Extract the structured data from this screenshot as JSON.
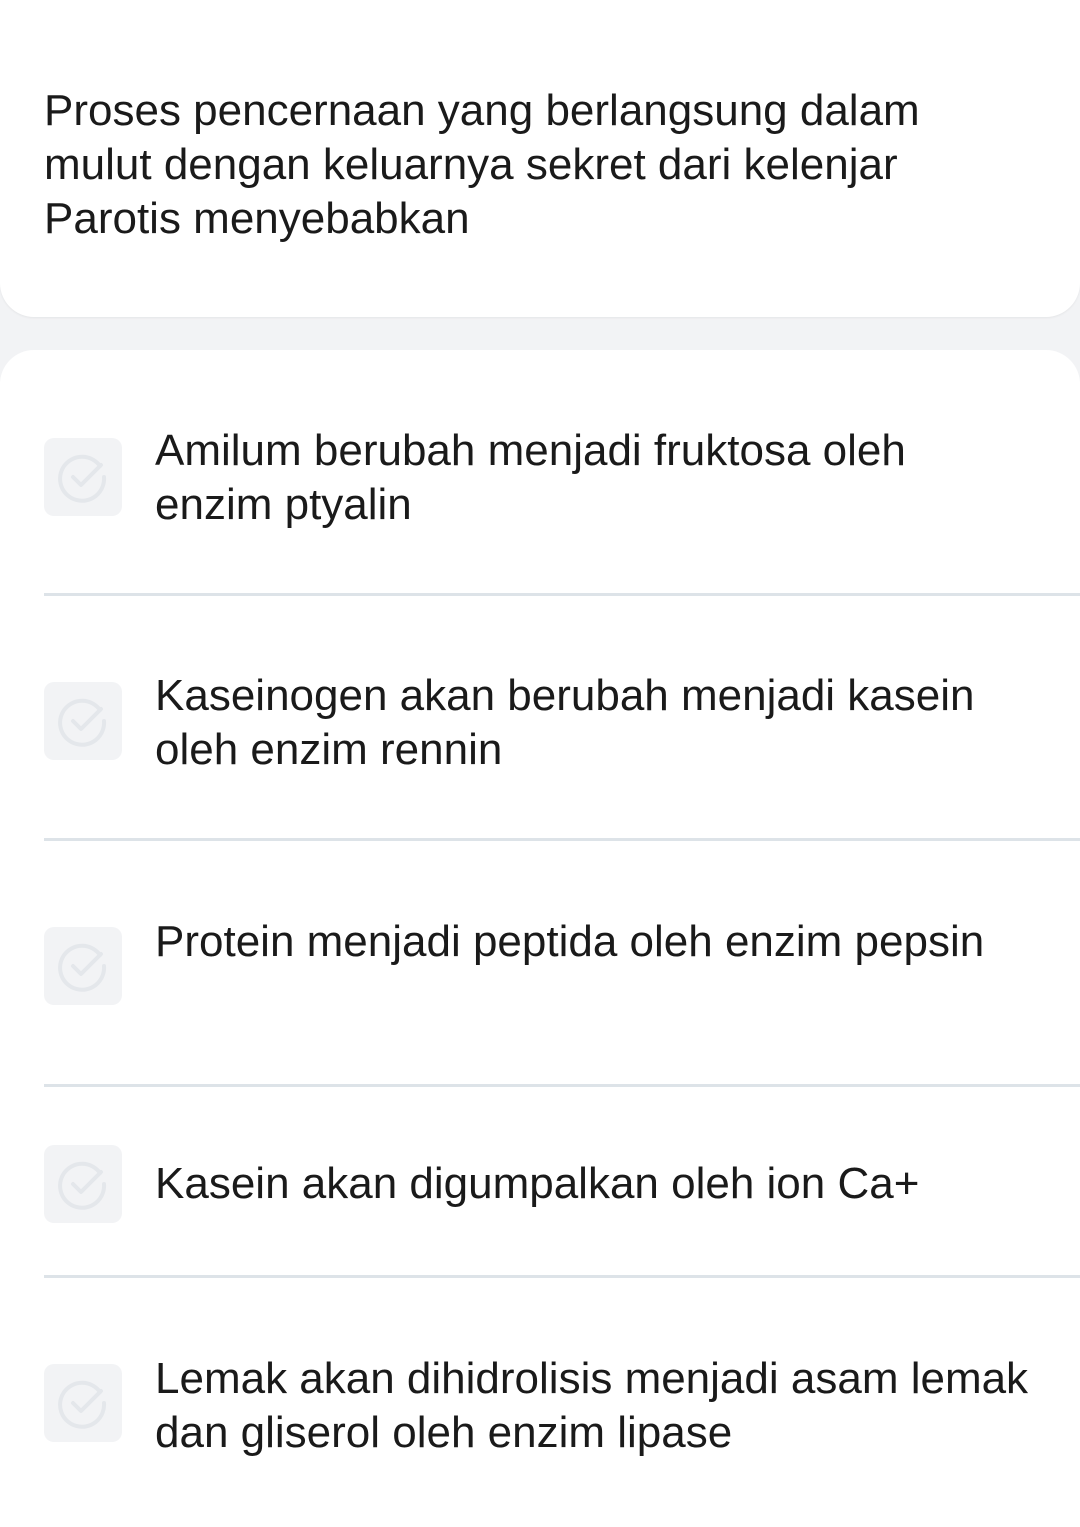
{
  "question": {
    "text": "Proses pencernaan yang berlangsung dalam mulut dengan keluarnya sekret dari kelenjar Parotis menyebabkan"
  },
  "options": [
    {
      "label": "Amilum berubah menjadi fruktosa oleh enzim ptyalin",
      "icon": "check-circle-icon",
      "selected": false
    },
    {
      "label": "Kaseinogen akan berubah menjadi kasein oleh enzim rennin",
      "icon": "check-circle-icon",
      "selected": false
    },
    {
      "label": "Protein menjadi peptida oleh enzim pepsin",
      "icon": "check-circle-icon",
      "selected": false
    },
    {
      "label": "Kasein akan digumpalkan oleh ion Ca+",
      "icon": "check-circle-icon",
      "selected": false
    },
    {
      "label": "Lemak akan dihidrolisis menjadi asam lemak dan gliserol oleh enzim lipase",
      "icon": "check-circle-icon",
      "selected": false
    }
  ],
  "colors": {
    "background": "#f2f3f5",
    "card": "#ffffff",
    "check_box": "#f2f3f5",
    "check_icon": "#e4e7eb",
    "divider": "#dde3e8",
    "text": "#1a1a1a"
  }
}
